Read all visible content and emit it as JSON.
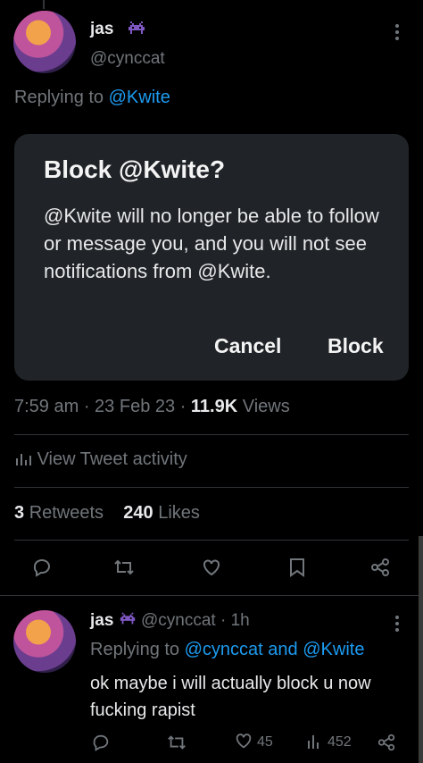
{
  "tweet": {
    "author_name": "jas",
    "author_handle": "@cynccat",
    "replying_prefix": "Replying to",
    "replying_to": "@Kwite",
    "time": "7:59 am",
    "date": "23 Feb 23",
    "views_count": "11.9K",
    "views_label": "Views",
    "activity_label": "View Tweet activity",
    "retweets_count": "3",
    "retweets_label": "Retweets",
    "likes_count": "240",
    "likes_label": "Likes"
  },
  "dialog": {
    "title": "Block @Kwite?",
    "body": "@Kwite will no longer be able to follow or message you, and you will not see notifications from @Kwite.",
    "cancel_label": "Cancel",
    "block_label": "Block"
  },
  "reply": {
    "author_name": "jas",
    "author_handle": "@cynccat",
    "separator": "·",
    "time": "1h",
    "replying_prefix": "Replying to",
    "replying_to_1": "@cynccat",
    "replying_conj": "and",
    "replying_to_2": "@Kwite",
    "text": "ok maybe i will actually block u now fucking rapist",
    "likes": "45",
    "views": "452"
  },
  "icons": {
    "badge": "space-invader-icon",
    "more": "more-vertical-icon",
    "reply": "reply-icon",
    "retweet": "retweet-icon",
    "like": "heart-icon",
    "bookmark": "bookmark-icon",
    "share": "share-icon",
    "analytics": "bar-chart-icon"
  },
  "colors": {
    "background": "#000000",
    "accent": "#1d9bf0",
    "muted": "#71767b",
    "dialog": "#202327",
    "badge": "#7e57c2"
  }
}
